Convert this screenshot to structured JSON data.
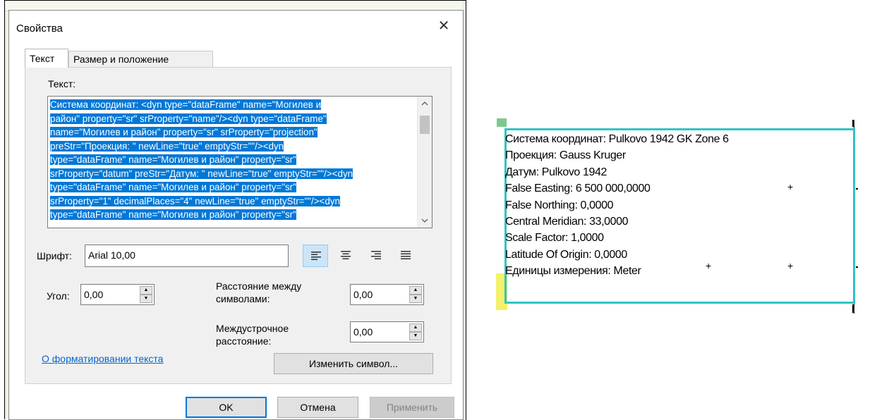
{
  "dialog": {
    "title": "Свойства",
    "close_label": "✕",
    "tabs": [
      {
        "label": "Текст",
        "active": true
      },
      {
        "label": "Размер и положение",
        "active": false
      }
    ],
    "text_label": "Текст:",
    "text_lines": [
      "Система координат: <dyn type=\"dataFrame\" name=\"Могилев и",
      "район\" property=\"sr\" srProperty=\"name\"/><dyn type=\"dataFrame\"",
      "name=\"Могилев и район\" property=\"sr\" srProperty=\"projection\"",
      "preStr=\"Проекция: \" newLine=\"true\" emptyStr=\"\"/><dyn",
      "type=\"dataFrame\" name=\"Могилев и район\" property=\"sr\"",
      "srProperty=\"datum\" preStr=\"Датум: \" newLine=\"true\" emptyStr=\"\"/><dyn",
      "type=\"dataFrame\" name=\"Могилев и район\" property=\"sr\"",
      "srProperty=\"1\" decimalPlaces=\"4\" newLine=\"true\" emptyStr=\"\"/><dyn",
      "type=\"dataFrame\" name=\"Могилев и район\" property=\"sr\""
    ],
    "font_label": "Шрифт:",
    "font_value": "Arial 10,00",
    "alignment_selected": "left",
    "angle_label": "Угол:",
    "angle_value": "0,00",
    "char_spacing_label_1": "Расстояние между",
    "char_spacing_label_2": "символами:",
    "char_spacing_value": "0,00",
    "leading_label_1": "Междустрочное",
    "leading_label_2": "расстояние:",
    "leading_value": "0,00",
    "format_link": "О форматировании текста",
    "change_symbol_button": "Изменить символ...",
    "ok_button": "OK",
    "cancel_button": "Отмена",
    "apply_button": "Применить"
  },
  "map_text": {
    "lines": [
      "Система координат: Pulkovo 1942 GK Zone 6",
      "Проекция: Gauss Kruger",
      "Датум: Pulkovo 1942",
      "False Easting: 6 500 000,0000",
      "False Northing: 0,0000",
      "Central Meridian: 33,0000",
      "Scale Factor: 1,0000",
      "Latitude Of Origin: 0,0000",
      "Единицы измерения: Meter"
    ],
    "selection_color": "#2ec4c4"
  },
  "colors": {
    "selection_highlight": "#0078d7",
    "ok_border": "#0078d7",
    "link": "#0066cc"
  }
}
